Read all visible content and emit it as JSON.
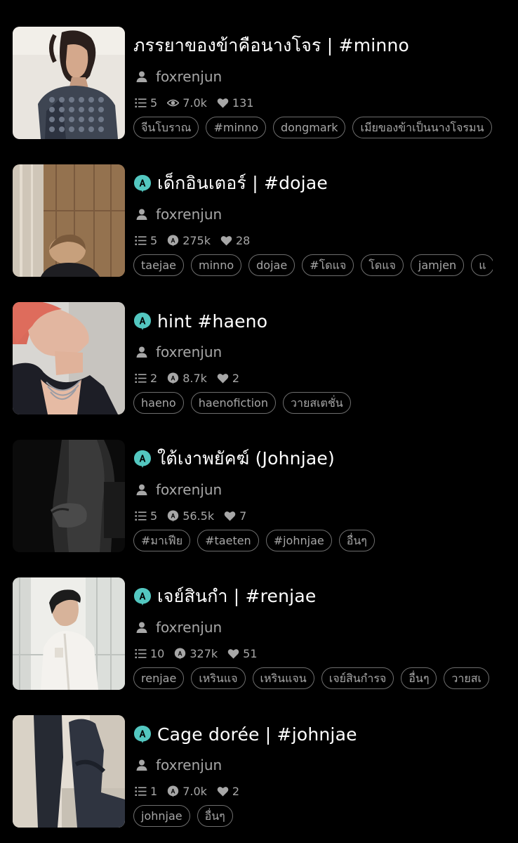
{
  "stories": [
    {
      "title": "ภรรยาของข้าคือนางโจร | #minno",
      "author": "foxrenjun",
      "has_badge": false,
      "parts": "5",
      "reads": "7.0k",
      "reads_icon": "eye-icon",
      "likes": "131",
      "tags": [
        "จีนโบราณ",
        "#minno",
        "dongmark",
        "เมียของข้าเป็นนางโจรมน"
      ]
    },
    {
      "title": "เด็กอินเตอร์ | #dojae",
      "author": "foxrenjun",
      "has_badge": true,
      "parts": "5",
      "reads": "275k",
      "reads_icon": "badge-reads-icon",
      "likes": "28",
      "tags": [
        "taejae",
        "minno",
        "dojae",
        "#โดแจ",
        "โดแจ",
        "jamjen",
        "แ"
      ]
    },
    {
      "title": "hint #haeno",
      "author": "foxrenjun",
      "has_badge": true,
      "parts": "2",
      "reads": "8.7k",
      "reads_icon": "badge-reads-icon",
      "likes": "2",
      "tags": [
        "haeno",
        "haenofiction",
        "วายสเตชั่น"
      ]
    },
    {
      "title": "ใต้เงาพยัคฆ์ (Johnjae)",
      "author": "foxrenjun",
      "has_badge": true,
      "parts": "5",
      "reads": "56.5k",
      "reads_icon": "badge-reads-icon",
      "likes": "7",
      "tags": [
        "#มาเฟีย",
        "#taeten",
        "#johnjae",
        "อื่นๆ"
      ]
    },
    {
      "title": "เจย์สินกำ | #renjae",
      "author": "foxrenjun",
      "has_badge": true,
      "parts": "10",
      "reads": "327k",
      "reads_icon": "badge-reads-icon",
      "likes": "51",
      "tags": [
        "renjae",
        "เหรินแจ",
        "เหรินแจน",
        "เจย์สินกำรจ",
        "อื่นๆ",
        "วายสเ"
      ]
    },
    {
      "title": "Cage dorée | #johnjae",
      "author": "foxrenjun",
      "has_badge": true,
      "parts": "1",
      "reads": "7.0k",
      "reads_icon": "badge-reads-icon",
      "likes": "2",
      "tags": [
        "johnjae",
        "อื่นๆ"
      ]
    }
  ],
  "colors": {
    "background": "#000000",
    "badge": "#53c7c0",
    "muted_text": "#a7a7a7",
    "tag_border": "#6e6e6e"
  }
}
